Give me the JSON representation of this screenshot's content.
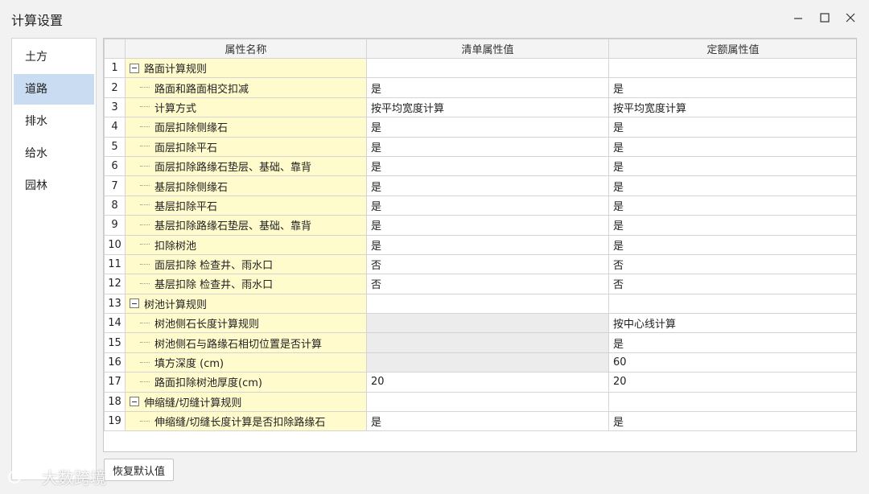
{
  "window": {
    "title": "计算设置"
  },
  "sidebar": {
    "items": [
      {
        "label": "土方"
      },
      {
        "label": "道路"
      },
      {
        "label": "排水"
      },
      {
        "label": "给水"
      },
      {
        "label": "园林"
      }
    ],
    "active_index": 1
  },
  "grid": {
    "headers": {
      "name": "属性名称",
      "list_value": "清单属性值",
      "quota_value": "定额属性值"
    },
    "rows": [
      {
        "num": "1",
        "name": "路面计算规则",
        "group": true,
        "list": "",
        "quota": ""
      },
      {
        "num": "2",
        "name": "路面和路面相交扣减",
        "group": false,
        "list": "是",
        "quota": "是"
      },
      {
        "num": "3",
        "name": "计算方式",
        "group": false,
        "list": "按平均宽度计算",
        "quota": "按平均宽度计算"
      },
      {
        "num": "4",
        "name": "面层扣除侧缘石",
        "group": false,
        "list": "是",
        "quota": "是"
      },
      {
        "num": "5",
        "name": "面层扣除平石",
        "group": false,
        "list": "是",
        "quota": "是"
      },
      {
        "num": "6",
        "name": "面层扣除路缘石垫层、基础、靠背",
        "group": false,
        "list": "是",
        "quota": "是"
      },
      {
        "num": "7",
        "name": "基层扣除侧缘石",
        "group": false,
        "list": "是",
        "quota": "是"
      },
      {
        "num": "8",
        "name": "基层扣除平石",
        "group": false,
        "list": "是",
        "quota": "是"
      },
      {
        "num": "9",
        "name": "基层扣除路缘石垫层、基础、靠背",
        "group": false,
        "list": "是",
        "quota": "是"
      },
      {
        "num": "10",
        "name": "扣除树池",
        "group": false,
        "list": "是",
        "quota": "是"
      },
      {
        "num": "11",
        "name": "面层扣除 检查井、雨水口",
        "group": false,
        "list": "否",
        "quota": "否"
      },
      {
        "num": "12",
        "name": "基层扣除 检查井、雨水口",
        "group": false,
        "list": "否",
        "quota": "否"
      },
      {
        "num": "13",
        "name": "树池计算规则",
        "group": true,
        "list": "",
        "quota": ""
      },
      {
        "num": "14",
        "name": "树池侧石长度计算规则",
        "group": false,
        "list": "",
        "quota": "按中心线计算",
        "list_disabled": true
      },
      {
        "num": "15",
        "name": "树池侧石与路缘石相切位置是否计算",
        "group": false,
        "list": "",
        "quota": "是",
        "list_disabled": true
      },
      {
        "num": "16",
        "name": "填方深度 (cm)",
        "group": false,
        "list": "",
        "quota": "60",
        "list_disabled": true
      },
      {
        "num": "17",
        "name": "路面扣除树池厚度(cm)",
        "group": false,
        "list": "20",
        "quota": "20"
      },
      {
        "num": "18",
        "name": "伸缩缝/切缝计算规则",
        "group": true,
        "list": "",
        "quota": ""
      },
      {
        "num": "19",
        "name": "伸缩缝/切缝长度计算是否扣除路缘石",
        "group": false,
        "list": "是",
        "quota": "是"
      }
    ]
  },
  "footer": {
    "restore_label": "恢复默认值"
  },
  "watermark": {
    "text": "大数跨境"
  }
}
